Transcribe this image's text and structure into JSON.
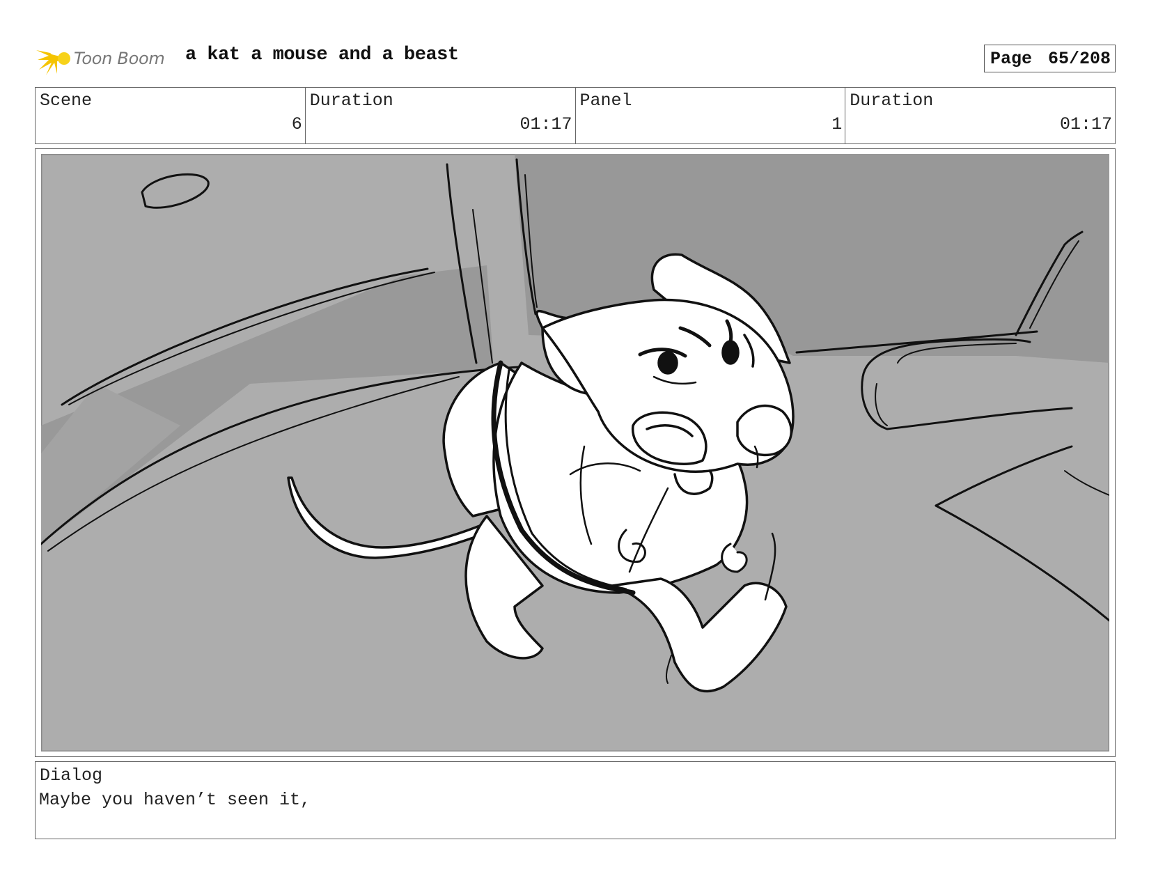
{
  "header": {
    "logo_text": "Toon Boom",
    "project_title": "a kat a mouse and a beast",
    "page_label": "Page",
    "page_value": "65/208"
  },
  "info": {
    "scene_label": "Scene",
    "scene_value": "6",
    "scene_duration_label": "Duration",
    "scene_duration_value": "01:17",
    "panel_label": "Panel",
    "panel_value": "1",
    "panel_duration_label": "Duration",
    "panel_duration_value": "01:17"
  },
  "dialog": {
    "label": "Dialog",
    "text": "Maybe you haven’t seen it,"
  },
  "colors": {
    "logo_yellow": "#f5c400",
    "sketch_bg_light": "#adadad",
    "sketch_bg_dark": "#989898",
    "ink": "#111111"
  }
}
